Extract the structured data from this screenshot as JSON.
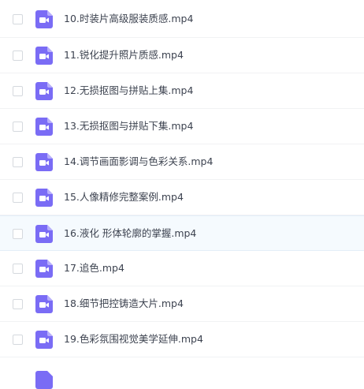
{
  "file_list": {
    "colors": {
      "icon_bg": "#7a6cf5",
      "icon_fold": "#b7aefb",
      "icon_glyph": "#ffffff",
      "text": "#3d4350",
      "hover_row": "#f5fafe"
    },
    "items": [
      {
        "name": "10.时装片高级服装质感.mp4",
        "icon": "video-file-icon"
      },
      {
        "name": "11.锐化提升照片质感.mp4",
        "icon": "video-file-icon"
      },
      {
        "name": "12.无损抠图与拼贴上集.mp4",
        "icon": "video-file-icon"
      },
      {
        "name": "13.无损抠图与拼贴下集.mp4",
        "icon": "video-file-icon"
      },
      {
        "name": "14.调节画面影调与色彩关系.mp4",
        "icon": "video-file-icon"
      },
      {
        "name": "15.人像精修完整案例.mp4",
        "icon": "video-file-icon"
      },
      {
        "name": "16.液化 形体轮廓的掌握.mp4",
        "icon": "video-file-icon"
      },
      {
        "name": "17.追色.mp4",
        "icon": "video-file-icon"
      },
      {
        "name": "18.细节把控铸造大片.mp4",
        "icon": "video-file-icon"
      },
      {
        "name": "19.色彩氛围视觉美学延伸.mp4",
        "icon": "video-file-icon"
      }
    ]
  }
}
